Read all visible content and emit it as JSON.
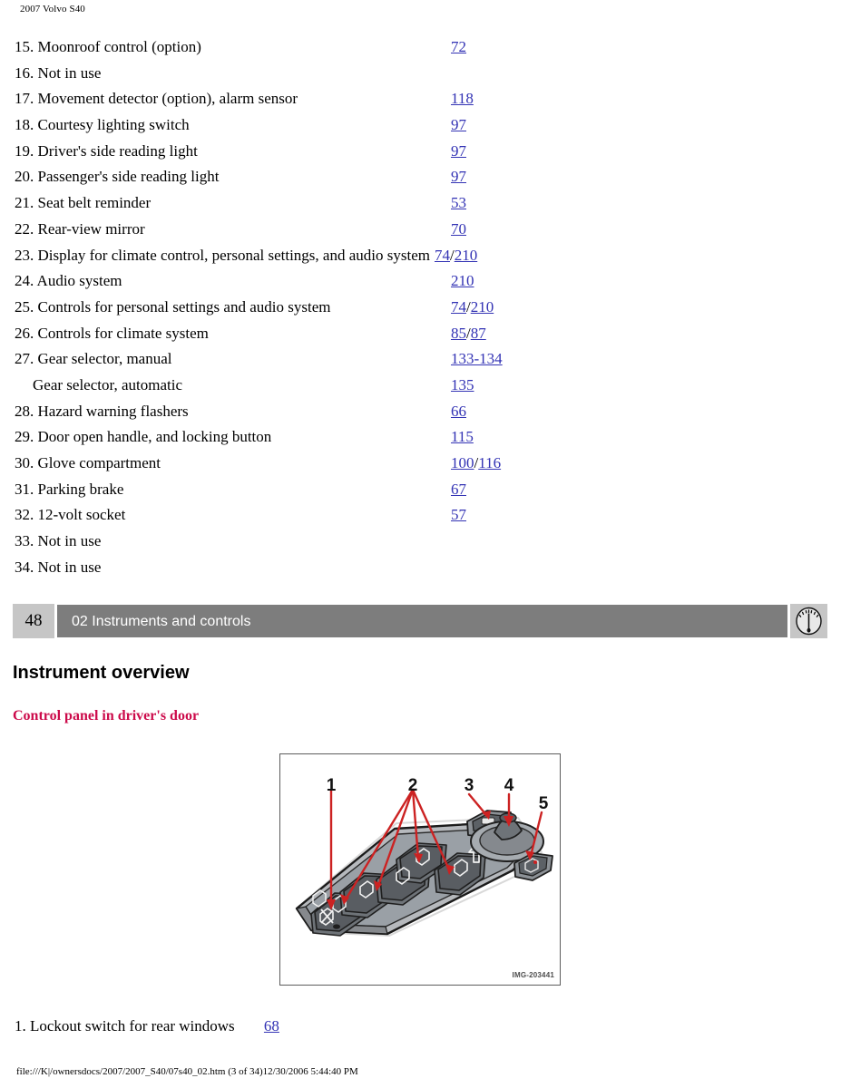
{
  "header": {
    "title": "2007 Volvo S40"
  },
  "reference_list": [
    {
      "number": "15.",
      "text": "Moonroof control (option)",
      "pages": [
        "72"
      ],
      "indented": false
    },
    {
      "number": "16.",
      "text": "Not in use",
      "pages": [],
      "indented": false
    },
    {
      "number": "17.",
      "text": "Movement detector (option), alarm sensor",
      "pages": [
        "118"
      ],
      "indented": false
    },
    {
      "number": "18.",
      "text": "Courtesy lighting switch",
      "pages": [
        "97"
      ],
      "indented": false
    },
    {
      "number": "19.",
      "text": "Driver's side reading light",
      "pages": [
        "97"
      ],
      "indented": false
    },
    {
      "number": "20.",
      "text": "Passenger's side reading light",
      "pages": [
        "97"
      ],
      "indented": false
    },
    {
      "number": "21.",
      "text": "Seat belt reminder",
      "pages": [
        "53"
      ],
      "indented": false
    },
    {
      "number": "22.",
      "text": "Rear-view mirror",
      "pages": [
        "70"
      ],
      "indented": false
    },
    {
      "number": "23.",
      "text": "Display for climate control, personal settings, and audio system",
      "pages": [
        "74",
        "210"
      ],
      "separator": "/",
      "indented": false,
      "long": true
    },
    {
      "number": "24.",
      "text": "Audio system",
      "pages": [
        "210"
      ],
      "indented": false
    },
    {
      "number": "25.",
      "text": "Controls for personal settings and audio system",
      "pages": [
        "74",
        "210"
      ],
      "separator": "/",
      "indented": false
    },
    {
      "number": "26.",
      "text": "Controls for climate system",
      "pages": [
        "85",
        "87"
      ],
      "separator": "/",
      "indented": false
    },
    {
      "number": "27.",
      "text": "Gear selector, manual",
      "pages": [
        "133-134"
      ],
      "indented": false
    },
    {
      "number": "",
      "text": "Gear selector, automatic",
      "pages": [
        "135"
      ],
      "indented": true
    },
    {
      "number": "28.",
      "text": "Hazard warning flashers",
      "pages": [
        "66"
      ],
      "indented": false
    },
    {
      "number": "29.",
      "text": "Door open handle, and locking button",
      "pages": [
        "115"
      ],
      "indented": false
    },
    {
      "number": "30.",
      "text": "Glove compartment",
      "pages": [
        "100",
        "116"
      ],
      "separator": "/",
      "indented": false
    },
    {
      "number": "31.",
      "text": "Parking brake",
      "pages": [
        "67"
      ],
      "indented": false
    },
    {
      "number": "32.",
      "text": "12-volt socket",
      "pages": [
        "57"
      ],
      "indented": false
    },
    {
      "number": "33.",
      "text": "Not in use",
      "pages": [],
      "indented": false
    },
    {
      "number": "34.",
      "text": "Not in use",
      "pages": [],
      "indented": false
    }
  ],
  "chapter_bar": {
    "page_number": "48",
    "chapter_title": "02 Instruments and controls",
    "icon": "gauge-icon",
    "bar_color": "#7d7d7d",
    "box_color": "#c6c6c6"
  },
  "section": {
    "heading": "Instrument overview",
    "sub_heading": "Control panel in driver's door",
    "sub_heading_color": "#cc0a4a"
  },
  "figure": {
    "alt": "Control panel in driver's door with numbered callouts",
    "callouts": [
      "1",
      "2",
      "3",
      "4",
      "5"
    ],
    "image_code": "IMG-203441",
    "callout_color": "#cc2222"
  },
  "figure_items": [
    {
      "number": "1.",
      "text": "Lockout switch for rear windows",
      "page": "68"
    }
  ],
  "print_footer": {
    "text": "file:///K|/ownersdocs/2007/2007_S40/07s40_02.htm (3 of 34)12/30/2006 5:44:40 PM"
  }
}
